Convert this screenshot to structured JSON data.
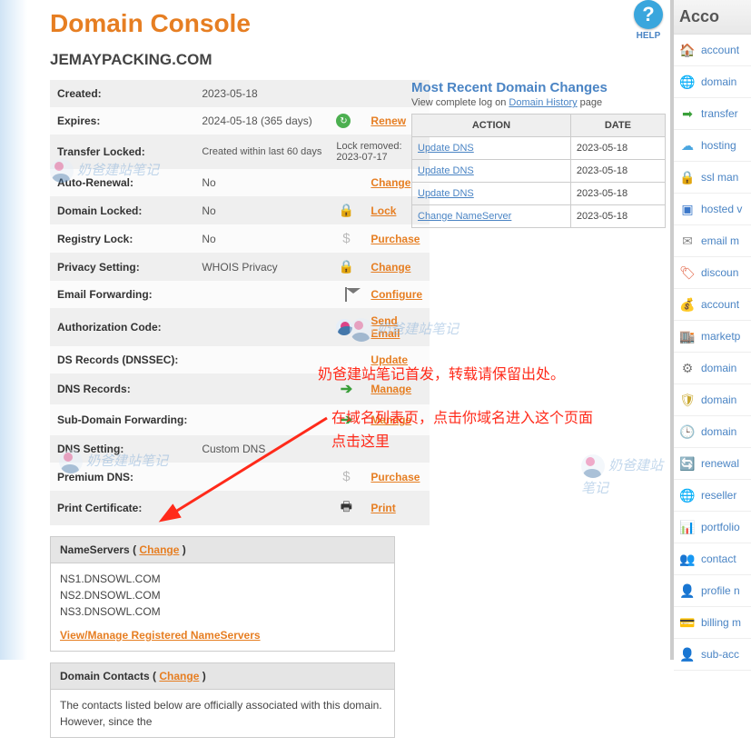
{
  "title": "Domain Console",
  "domain_name": "JEMAYPACKING.COM",
  "help": {
    "icon": "?",
    "label": "HELP"
  },
  "info_rows": [
    {
      "label": "Created:",
      "value": "2023-05-18",
      "icon": "",
      "action": ""
    },
    {
      "label": "Expires:",
      "value": "2024-05-18 (365 days)",
      "icon": "green-refresh",
      "action": "Renew"
    },
    {
      "label": "Transfer Locked:",
      "value": "Created within last 60 days",
      "note": "Lock removed: 2023-07-17"
    },
    {
      "label": "Auto-Renewal:",
      "value": "No",
      "icon": "globe",
      "action": "Change"
    },
    {
      "label": "Domain Locked:",
      "value": "No",
      "icon": "lock",
      "action": "Lock"
    },
    {
      "label": "Registry Lock:",
      "value": "No",
      "icon": "dollar",
      "action": "Purchase"
    },
    {
      "label": "Privacy Setting:",
      "value": "WHOIS Privacy",
      "icon": "lock",
      "action": "Change"
    },
    {
      "label": "Email Forwarding:",
      "value": "",
      "icon": "envelope",
      "action": "Configure"
    },
    {
      "label": "Authorization Code:",
      "value": "",
      "icon": "avatar",
      "action": "Send Email"
    },
    {
      "label": "DS Records (DNSSEC):",
      "value": "",
      "icon": "key",
      "action": "Update"
    },
    {
      "label": "DNS Records:",
      "value": "",
      "icon": "arrow",
      "action": "Manage"
    },
    {
      "label": "Sub-Domain Forwarding:",
      "value": "",
      "icon": "arrow",
      "action": "Manage"
    },
    {
      "label": "DNS Setting:",
      "value": "Custom DNS",
      "icon": "",
      "action": ""
    },
    {
      "label": "Premium DNS:",
      "value": "",
      "icon": "dollar",
      "action": "Purchase"
    },
    {
      "label": "Print Certificate:",
      "value": "",
      "icon": "printer",
      "action": "Print"
    }
  ],
  "nameservers": {
    "header": "NameServers",
    "change": "Change",
    "servers": [
      "NS1.DNSOWL.COM",
      "NS2.DNSOWL.COM",
      "NS3.DNSOWL.COM"
    ],
    "view_link": "View/Manage Registered NameServers"
  },
  "contacts": {
    "header": "Domain Contacts",
    "change": "Change",
    "note": "The contacts listed below are officially associated with this domain. However, since the"
  },
  "recent": {
    "title": "Most Recent Domain Changes",
    "sub_pre": "View complete log on ",
    "sub_link": "Domain History",
    "sub_post": " page",
    "col_action": "ACTION",
    "col_date": "DATE",
    "rows": [
      {
        "action": "Update DNS",
        "date": "2023-05-18"
      },
      {
        "action": "Update DNS",
        "date": "2023-05-18"
      },
      {
        "action": "Update DNS",
        "date": "2023-05-18"
      },
      {
        "action": "Change NameServer",
        "date": "2023-05-18"
      }
    ]
  },
  "sidebar": {
    "header": "Acco",
    "items": [
      {
        "label": "account",
        "icon": "🏠",
        "color": "#d4a850"
      },
      {
        "label": "domain",
        "icon": "🌐",
        "color": "#d63333"
      },
      {
        "label": "transfer",
        "icon": "➡",
        "color": "#3aa03a"
      },
      {
        "label": "hosting",
        "icon": "☁",
        "color": "#4aa6e0"
      },
      {
        "label": "ssl man",
        "icon": "🔒",
        "color": "#b89020"
      },
      {
        "label": "hosted v",
        "icon": "▣",
        "color": "#3a77c9"
      },
      {
        "label": "email m",
        "icon": "✉",
        "color": "#888"
      },
      {
        "label": "discoun",
        "icon": "🏷",
        "color": "#e05a3a"
      },
      {
        "label": "account",
        "icon": "💰",
        "color": "#8a9a5a"
      },
      {
        "label": "marketp",
        "icon": "🏬",
        "color": "#d05a8a"
      },
      {
        "label": "domain",
        "icon": "⚙",
        "color": "#777"
      },
      {
        "label": "domain",
        "icon": "🛡",
        "color": "#c9a830"
      },
      {
        "label": "domain",
        "icon": "🕒",
        "color": "#888"
      },
      {
        "label": "renewal",
        "icon": "🔄",
        "color": "#3aa03a"
      },
      {
        "label": "reseller",
        "icon": "🌐",
        "color": "#3a77c9"
      },
      {
        "label": "portfolio",
        "icon": "📊",
        "color": "#d68a30"
      },
      {
        "label": "contact",
        "icon": "👥",
        "color": "#4aa6e0"
      },
      {
        "label": "profile n",
        "icon": "👤",
        "color": "#333"
      },
      {
        "label": "billing m",
        "icon": "💳",
        "color": "#4aa6e0"
      },
      {
        "label": "sub-acc",
        "icon": "👤",
        "color": "#c9a830"
      }
    ]
  },
  "annotations": {
    "a1": "奶爸建站笔记首发，转载请保留出处。",
    "a2": "在域名列表页，点击你域名进入这个页面",
    "a3": "点击这里",
    "wm": "奶爸建站笔记"
  }
}
